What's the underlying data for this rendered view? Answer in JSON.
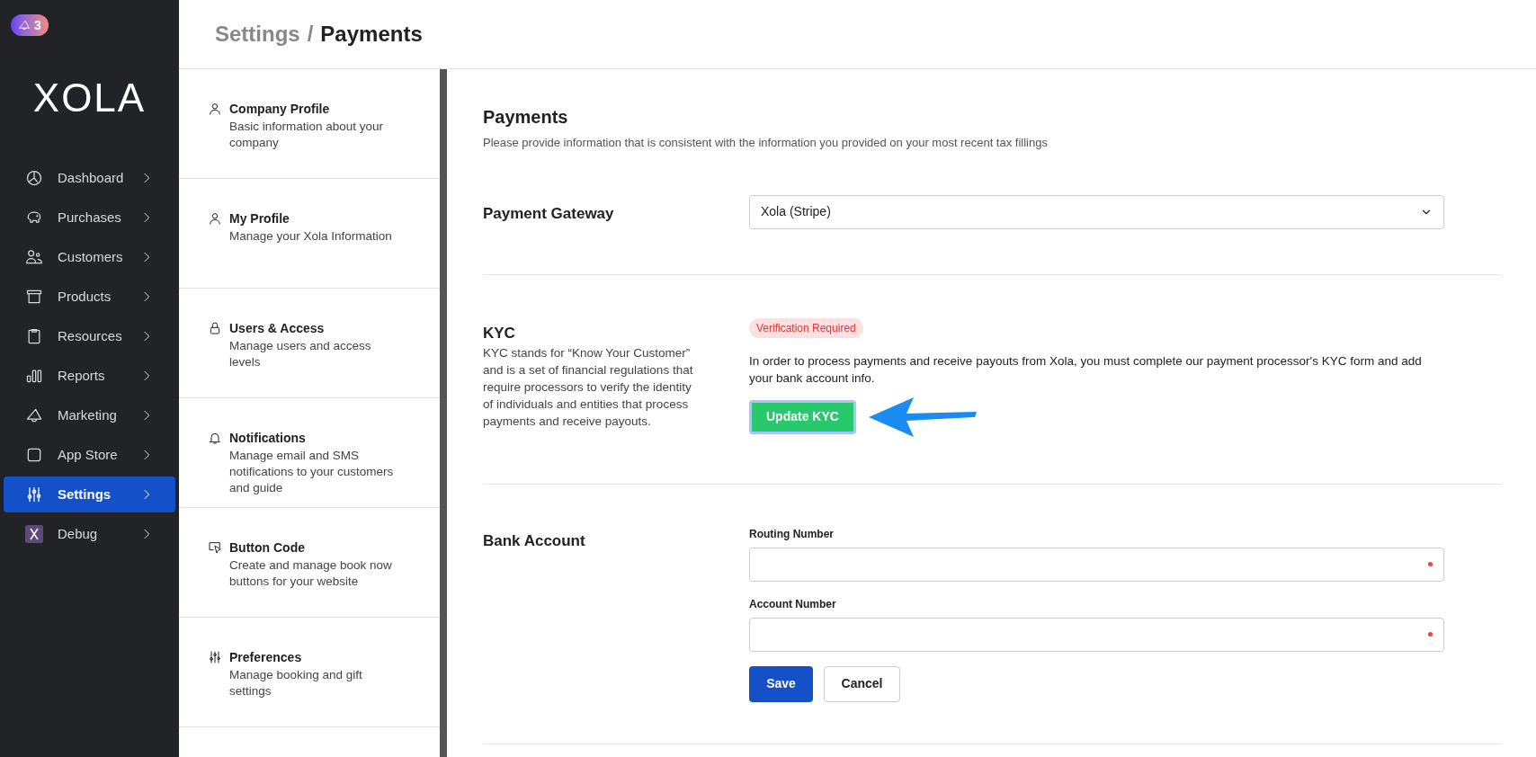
{
  "badge": {
    "count": "3"
  },
  "logo": "XOLA",
  "nav": [
    {
      "label": "Dashboard",
      "selected": false
    },
    {
      "label": "Purchases",
      "selected": false
    },
    {
      "label": "Customers",
      "selected": false
    },
    {
      "label": "Products",
      "selected": false
    },
    {
      "label": "Resources",
      "selected": false
    },
    {
      "label": "Reports",
      "selected": false
    },
    {
      "label": "Marketing",
      "selected": false
    },
    {
      "label": "App Store",
      "selected": false
    },
    {
      "label": "Settings",
      "selected": true
    },
    {
      "label": "Debug",
      "selected": false
    }
  ],
  "breadcrumb": {
    "parent": "Settings",
    "separator": "/",
    "current": "Payments"
  },
  "settings_menu": [
    {
      "title": "Company Profile",
      "description": "Basic information about your company"
    },
    {
      "title": "My Profile",
      "description": "Manage your Xola Information"
    },
    {
      "title": "Users & Access",
      "description": "Manage users and access levels"
    },
    {
      "title": "Notifications",
      "description": "Manage email and SMS notifications to your customers and guide"
    },
    {
      "title": "Button Code",
      "description": "Create and manage book now buttons for your website"
    },
    {
      "title": "Preferences",
      "description": "Manage booking and gift settings"
    }
  ],
  "page": {
    "title": "Payments",
    "subtitle": "Please provide information that is consistent with the information you provided on your most recent tax fillings"
  },
  "gateway": {
    "label": "Payment Gateway",
    "value": "Xola (Stripe)"
  },
  "kyc": {
    "title": "KYC",
    "description": "KYC stands for “Know Your Customer” and is a set of financial regulations that require processors to verify the identity of individuals and entities that process payments and receive payouts.",
    "status": "Verification Required",
    "message": "In order to process payments and receive payouts from Xola, you must complete our payment processor's KYC form and add your bank account info.",
    "button": "Update KYC"
  },
  "bank": {
    "title": "Bank Account",
    "fields": [
      {
        "label": "Routing Number",
        "required": true
      },
      {
        "label": "Account Number",
        "required": true
      }
    ],
    "save": "Save",
    "cancel": "Cancel"
  }
}
